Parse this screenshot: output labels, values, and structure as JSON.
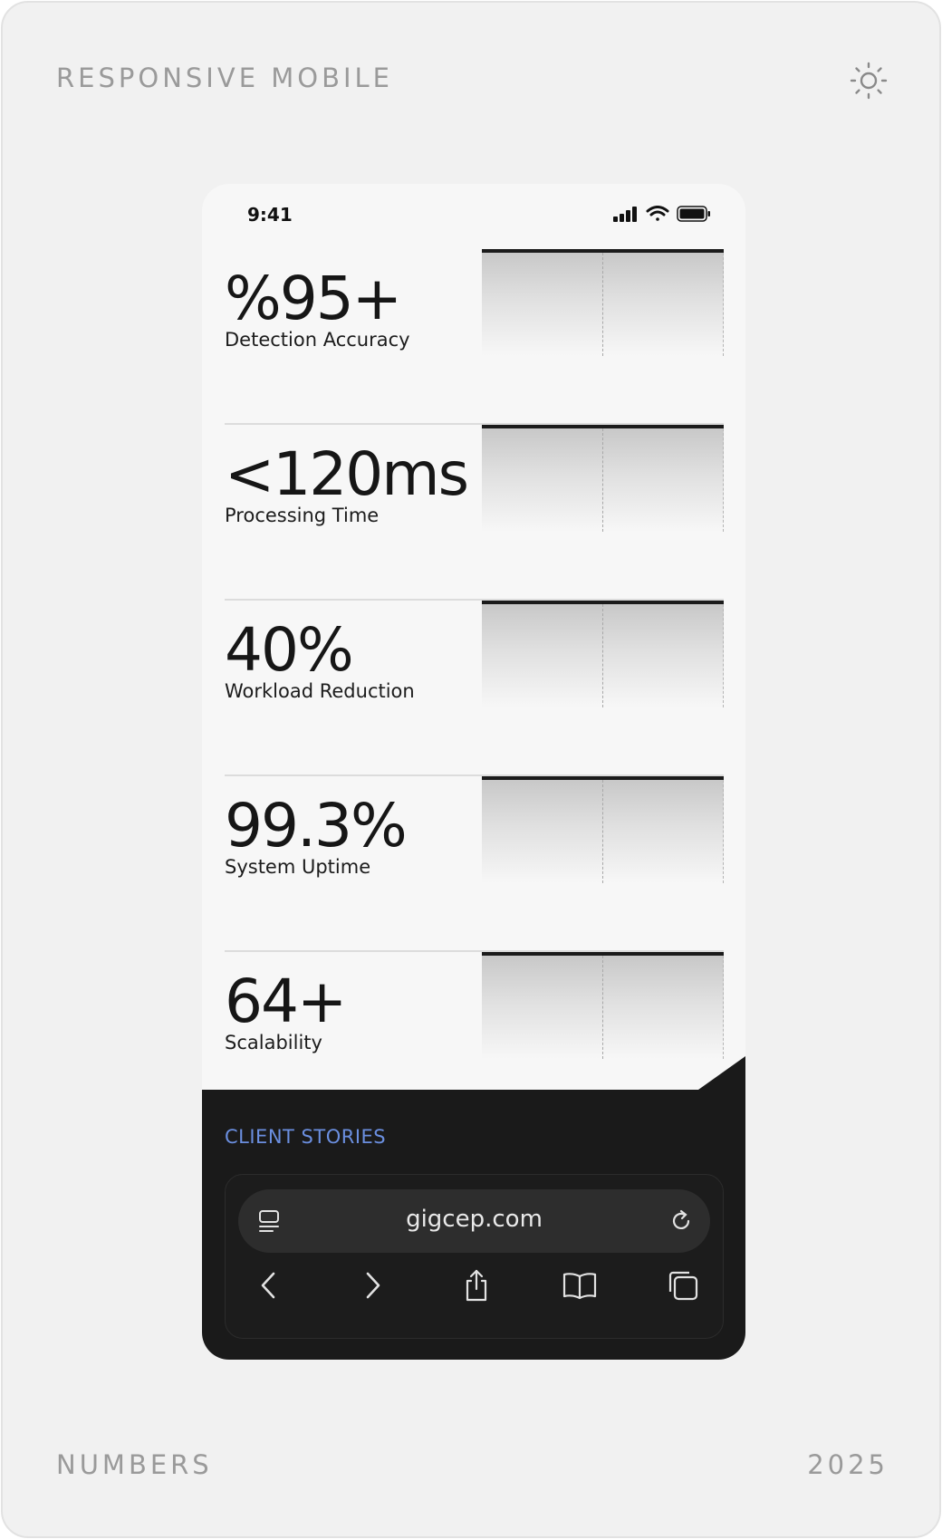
{
  "header": {
    "title": "RESPONSIVE MOBILE",
    "theme_icon": "sun-icon"
  },
  "footer": {
    "left": "NUMBERS",
    "right": "2025"
  },
  "status_bar": {
    "time": "9:41",
    "icons": [
      "signal-icon",
      "wifi-icon",
      "battery-icon"
    ]
  },
  "stats": [
    {
      "value": "%95+",
      "label": "Detection Accuracy"
    },
    {
      "value": "<120ms",
      "label": "Processing Time"
    },
    {
      "value": "40%",
      "label": "Workload Reduction"
    },
    {
      "value": "99.3%",
      "label": "System Uptime"
    },
    {
      "value": "64+",
      "label": "Scalability"
    }
  ],
  "client_section": {
    "label": "CLIENT STORIES"
  },
  "browser": {
    "url": "gigcep.com",
    "left_icon": "reader-icon",
    "right_icon": "reload-icon",
    "nav": [
      "back-icon",
      "forward-icon",
      "share-icon",
      "bookmarks-icon",
      "tabs-icon"
    ]
  },
  "colors": {
    "accent": "#6b8fe0",
    "dark_bg": "#1a1a1a",
    "card_bg": "#f1f1f1",
    "phone_bg": "#f7f7f7"
  }
}
